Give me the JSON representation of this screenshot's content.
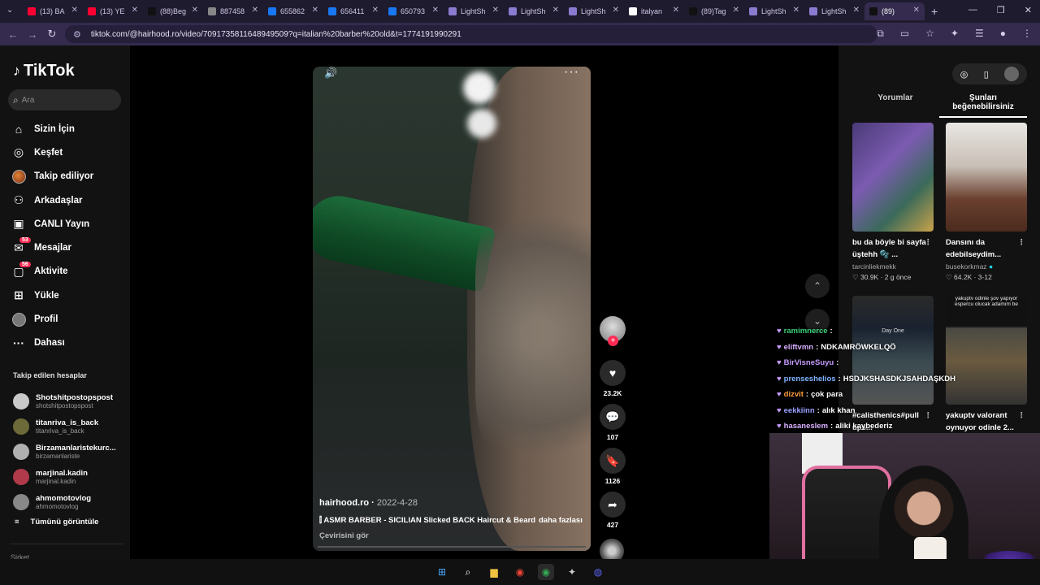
{
  "browser": {
    "tabs": [
      {
        "label": "(13) BA",
        "color": "#ff0033"
      },
      {
        "label": "(13) YE",
        "color": "#ff0033"
      },
      {
        "label": "(88)Beg",
        "color": "#111111"
      },
      {
        "label": "887458",
        "color": "#888888"
      },
      {
        "label": "655862",
        "color": "#1877f2"
      },
      {
        "label": "656411",
        "color": "#1877f2"
      },
      {
        "label": "650793",
        "color": "#1877f2"
      },
      {
        "label": "LightSh",
        "color": "#8a7bd0"
      },
      {
        "label": "LightSh",
        "color": "#8a7bd0"
      },
      {
        "label": "LightSh",
        "color": "#8a7bd0"
      },
      {
        "label": "italyan",
        "color": "#ffffff"
      },
      {
        "label": "(89)Tag",
        "color": "#111111"
      },
      {
        "label": "LightSh",
        "color": "#8a7bd0"
      },
      {
        "label": "LightSh",
        "color": "#8a7bd0"
      },
      {
        "label": "(89) ",
        "color": "#111111",
        "active": true
      }
    ],
    "url": "tiktok.com/@hairhood.ro/video/7091735811648949509?q=italian%20barber%20old&t=1774191990291"
  },
  "sidebar": {
    "logo": "TikTok",
    "search_placeholder": "Ara",
    "items": [
      {
        "label": "Sizin İçin",
        "icon": "home-icon"
      },
      {
        "label": "Keşfet",
        "icon": "compass-icon"
      },
      {
        "label": "Takip ediliyor",
        "icon": "avatar-icon"
      },
      {
        "label": "Arkadaşlar",
        "icon": "friends-icon"
      },
      {
        "label": "CANLI Yayın",
        "icon": "live-icon"
      },
      {
        "label": "Mesajlar",
        "icon": "message-icon",
        "badge": "53"
      },
      {
        "label": "Aktivite",
        "icon": "activity-icon",
        "badge": "56"
      },
      {
        "label": "Yükle",
        "icon": "upload-icon"
      },
      {
        "label": "Profil",
        "icon": "profile-icon"
      },
      {
        "label": "Dahası",
        "icon": "more-icon"
      }
    ],
    "following_title": "Takip edilen hesaplar",
    "following": [
      {
        "name": "Shotshitpostopspost",
        "handle": "shotshitpostopspost",
        "color": "#c9c9c9"
      },
      {
        "name": "titanriva_is_back",
        "handle": "titanriva_is_back",
        "color": "#6d6a3a"
      },
      {
        "name": "Birzamanlaristekurc...",
        "handle": "birzamanlariste",
        "color": "#b0b0b0"
      },
      {
        "name": "marjinal.kadin",
        "handle": "marjinal.kadin",
        "color": "#b03a4a"
      },
      {
        "name": "ahmomotovlog",
        "handle": "ahmomotovlog",
        "color": "#888888"
      }
    ],
    "see_all": "Tümünü görüntüle",
    "footer": "Şirket"
  },
  "video": {
    "author": "hairhood.ro",
    "date": "2022-4-28",
    "description": "ASMR BARBER - SICILIAN Slicked BACK Haircut & Beard",
    "more": "daha fazlası",
    "translate": "Çevirisini gör",
    "likes": "23.2K",
    "comments": "107",
    "saves": "1126",
    "shares": "427"
  },
  "right": {
    "tabs": [
      "Yorumlar",
      "Şunları beğenebilirsiniz"
    ],
    "cards": [
      {
        "title": "bu da böyle bi sayfa üştehh 🫧 ...",
        "user": "tarcinliekmekk",
        "likes": "30.9K",
        "time": "2 g önce"
      },
      {
        "title": "Dansını da edebilseydim...",
        "user": "busekorkmaz",
        "likes": "64.2K",
        "time": "3-12"
      },
      {
        "title": "#calisthenics#pull ups...",
        "overlay": "Day One"
      },
      {
        "title": "yakuptv valorant oynuyor odinle 2...",
        "overlay": "yakuptv odinle şov yapıyor espercu olucak adamım be"
      }
    ]
  },
  "chat": [
    {
      "user": "ramimnerce",
      "text": "",
      "color": "#3ad17a"
    },
    {
      "user": "eliftvmn",
      "text": "NDKAMRÖWKELQÖ",
      "color": "#d8b0ff"
    },
    {
      "user": "BirVisneSuyu",
      "text": "",
      "color": "#c79cff"
    },
    {
      "user": "prenseshelios",
      "text": "HSDJKSHASDKJSAHDAŞKDH",
      "color": "#7fb3ff"
    },
    {
      "user": "dizvit",
      "text": "çok para",
      "color": "#ff9e3d"
    },
    {
      "user": "eekkiinn",
      "text": "alık khan",
      "color": "#9aa0ff"
    },
    {
      "user": "hasaneslem",
      "text": "aliki kaybederiz",
      "color": "#d8b0ff"
    }
  ]
}
